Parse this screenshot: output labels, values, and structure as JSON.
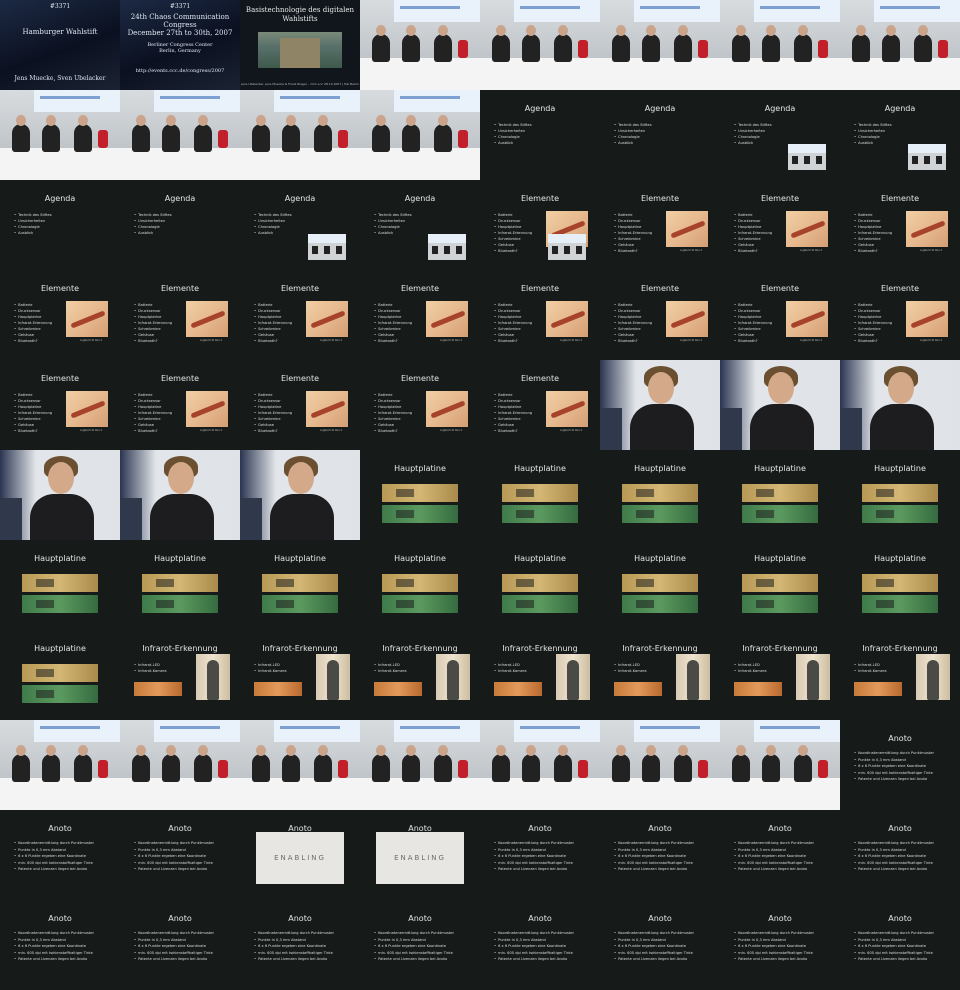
{
  "intro": {
    "tile1": {
      "line1": "#3371",
      "line2": "Hamburger Wahlstift",
      "line3": "Jens Muecke, Sven Ubelacker"
    },
    "tile2": {
      "line1": "#3371",
      "line2": "24th Chaos Communication Congress\nDecember 27th to 30th, 2007",
      "line3": "Berliner Congress Center\nBerlin, Germany",
      "line4": "http://events.ccc.de/congress/2007"
    },
    "tile3": {
      "title": "Basistechnologie des digitalen Wahlstifts",
      "footer": "Jens Ubelacker, Jens Muecke & Frank Rieger – CCC e.V. 28.12.2007 | Hal Berlin"
    }
  },
  "slides": {
    "agenda": {
      "title": "Agenda",
      "items": [
        "Technik des Stiftes",
        "Unsicherheiten",
        "Chronologie",
        "Ausblick"
      ]
    },
    "elemente": {
      "title": "Elemente",
      "items": [
        "Batterie",
        "Drucksensor",
        "Hauptplatine",
        "Infrarot-Erkennung",
        "Schreibmine",
        "Gehäuse",
        "Bluetooth?"
      ],
      "caption": "Logitech IO Pen 2"
    },
    "hauptplatine": {
      "title": "Hauptplatine"
    },
    "infrarot": {
      "title": "Infrarot-Erkennung",
      "items": [
        "Infrarot-LED",
        "Infrarot-Kamera"
      ]
    },
    "anoto": {
      "title": "Anoto",
      "items": [
        "Koordinatenermittlung durch Punktmuster",
        "Punkte in 0,3 mm Abstand",
        "6 x 6 Punkte ergeben eine Koordinate",
        "min. 600 dpi mit kohlenstoffhaltiger Tinte",
        "Patente und Lizenzen liegen bei Anoto"
      ],
      "image_text": "ENABLING"
    }
  }
}
